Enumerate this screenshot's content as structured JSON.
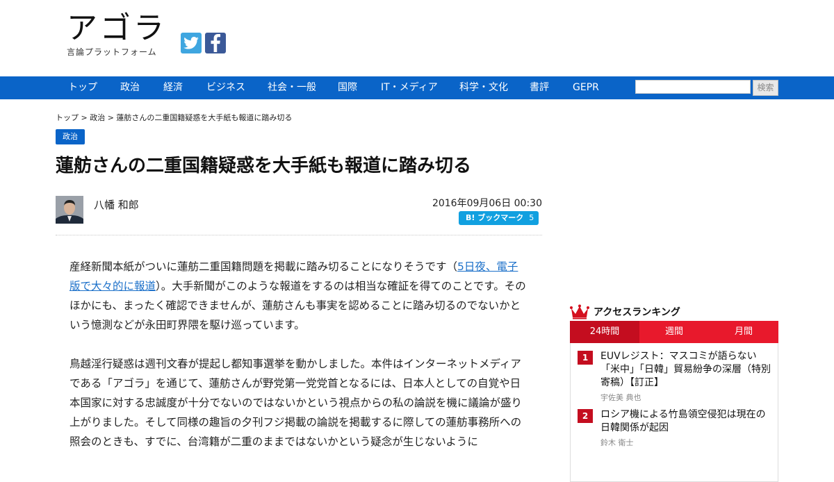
{
  "header": {
    "logo_main": "アゴラ",
    "logo_sub": "言論プラットフォーム"
  },
  "nav": {
    "items": [
      "トップ",
      "政治",
      "経済",
      "ビジネス",
      "社会・一般",
      "国際",
      "IT・メディア",
      "科学・文化",
      "書評",
      "GEPR"
    ],
    "search_placeholder": "",
    "search_button": "検索"
  },
  "article": {
    "breadcrumb": "トップ > 政治 > 蓮舫さんの二重国籍疑惑を大手紙も報道に踏み切る",
    "category": "政治",
    "title": "蓮舫さんの二重国籍疑惑を大手紙も報道に踏み切る",
    "author": "八幡 和郎",
    "date": "2016年09月06日 00:30",
    "bookmark_label": "B! ブックマーク",
    "bookmark_count": "5",
    "p1_before": "産経新聞本紙がついに蓮舫二重国籍問題を掲載に踏み切ることになりそうです（",
    "p1_link": "5日夜、電子版で大々的に報道",
    "p1_after": "）。大手新聞がこのような報道をするのは相当な確証を得てのことです。そのほかにも、まったく確認できませんが、蓮舫さんも事実を認めることに踏み切るのでないかという憶測などが永田町界隈を駆け巡っています。",
    "p2": "鳥越淫行疑惑は週刊文春が提起し都知事選挙を動かしました。本件はインターネットメディアである「アゴラ」を通じて、蓮舫さんが野党第一党党首となるには、日本人としての自覚や日本国家に対する忠誠度が十分でないのではないかという視点からの私の論説を機に議論が盛り上がりました。そして同様の趣旨の夕刊フジ掲載の論説を掲載するに際しての蓮舫事務所への照会のときも、すでに、台湾籍が二重のままではないかという疑念が生じないように"
  },
  "ranking": {
    "heading": "アクセスランキング",
    "tabs": [
      "24時間",
      "週間",
      "月間"
    ],
    "items": [
      {
        "rank": "1",
        "title": "EUVレジスト：マスコミが語らない「米中」「日韓」貿易紛争の深層（特別寄稿）【訂正】",
        "author": "宇佐美 典也"
      },
      {
        "rank": "2",
        "title": "ロシア機による竹島領空侵犯は現在の日韓関係が起因",
        "author": "鈴木 衛士"
      }
    ]
  },
  "colors": {
    "nav_blue": "#0a64c8",
    "ranking_red": "#e8192c",
    "ranking_dark_red": "#c40d1f",
    "link_blue": "#1a6fc9",
    "hatena_blue": "#11a0e0"
  }
}
